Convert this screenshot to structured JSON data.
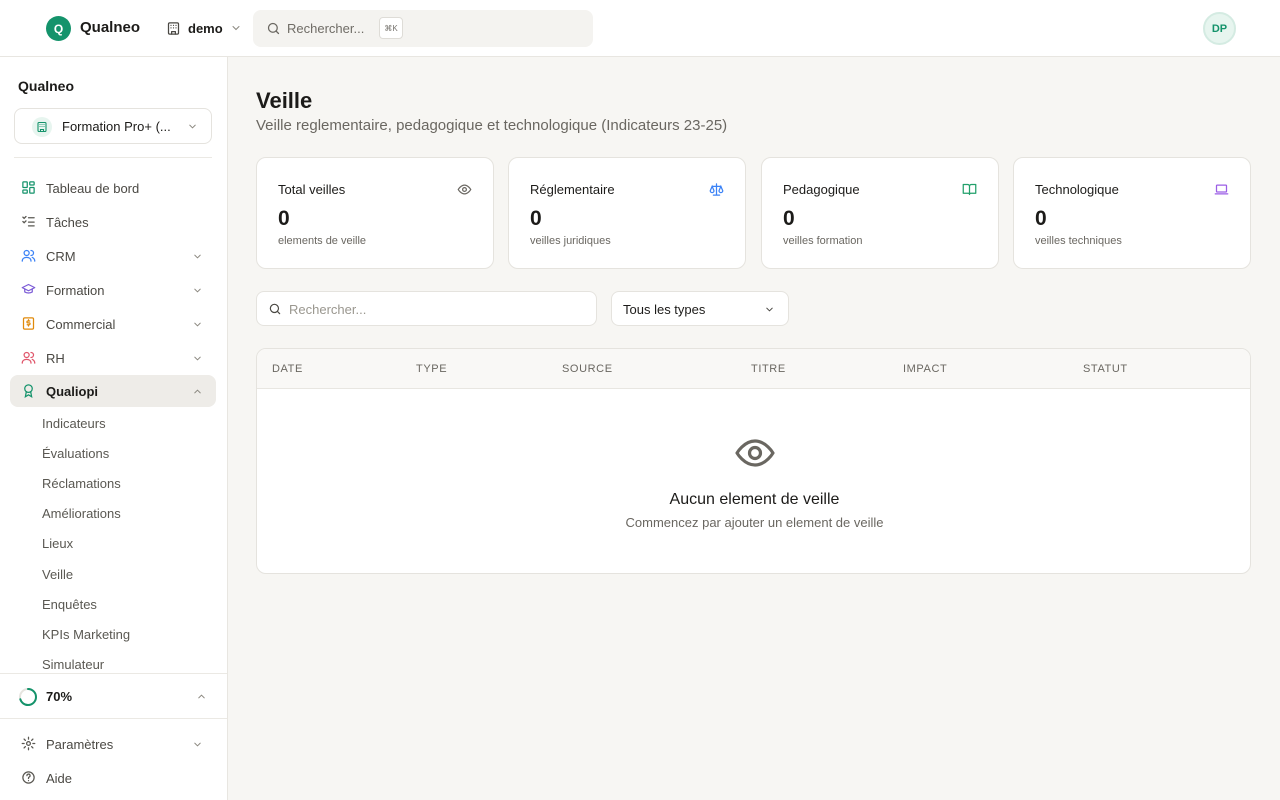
{
  "app": {
    "logo_letter": "Q",
    "brand": "Qualneo",
    "org_switch": "demo",
    "search_placeholder": "Rechercher...",
    "search_shortcut": "⌘K",
    "avatar_initials": "DP"
  },
  "sidebar": {
    "title": "Qualneo",
    "org_name": "Formation Pro+ (...",
    "items": [
      {
        "label": "Tableau de bord",
        "icon": "grid-icon"
      },
      {
        "label": "Tâches",
        "icon": "checklist-icon"
      },
      {
        "label": "CRM",
        "icon": "users-icon"
      },
      {
        "label": "Formation",
        "icon": "graduation-cap-icon"
      },
      {
        "label": "Commercial",
        "icon": "dollar-icon"
      },
      {
        "label": "RH",
        "icon": "people-icon"
      },
      {
        "label": "Qualiopi",
        "icon": "award-icon"
      }
    ],
    "subitems": [
      "Indicateurs",
      "Évaluations",
      "Réclamations",
      "Améliorations",
      "Lieux",
      "Veille",
      "Enquêtes",
      "KPIs Marketing",
      "Simulateur"
    ],
    "progress_label": "70%",
    "progress_value": 0.7,
    "footer_items": [
      {
        "label": "Paramètres",
        "icon": "gear-icon"
      },
      {
        "label": "Aide",
        "icon": "help-icon"
      }
    ]
  },
  "page": {
    "title": "Veille",
    "subtitle": "Veille reglementaire, pedagogique et technologique (Indicateurs 23-25)"
  },
  "stats": [
    {
      "title": "Total veilles",
      "value": "0",
      "desc": "elements de veille",
      "icon": "eye-icon",
      "color": "#6a6761"
    },
    {
      "title": "Réglementaire",
      "value": "0",
      "desc": "veilles juridiques",
      "icon": "scale-icon",
      "color": "#3b82f6"
    },
    {
      "title": "Pedagogique",
      "value": "0",
      "desc": "veilles formation",
      "icon": "book-icon",
      "color": "#22a06b"
    },
    {
      "title": "Technologique",
      "value": "0",
      "desc": "veilles techniques",
      "icon": "laptop-icon",
      "color": "#9b5de5"
    }
  ],
  "filters": {
    "search_placeholder": "Rechercher...",
    "type_value": "Tous les types"
  },
  "table": {
    "columns": [
      "DATE",
      "TYPE",
      "SOURCE",
      "TITRE",
      "IMPACT",
      "STATUT"
    ],
    "empty_title": "Aucun element de veille",
    "empty_sub": "Commencez par ajouter un element de veille"
  }
}
